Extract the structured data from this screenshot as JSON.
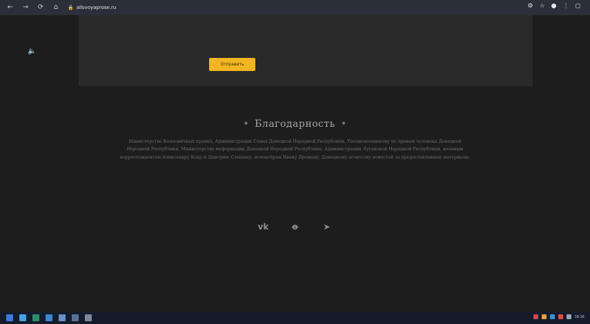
{
  "browser": {
    "url": "allsvoyaprose.ru",
    "nav": [
      "←",
      "→",
      "⟳",
      "⌂"
    ]
  },
  "form": {
    "consent_text": "",
    "submit_label": "Отправить"
  },
  "thanks": {
    "title": "Благодарность",
    "text": "Министерство Колесничных правил, Администрации Главы Донецкой Народной Республики, Уполномоченному по правам человека Донецкой Народной Республики, Министерству информации Донецкой Народной Республики, Администрации Луганской Народной Республики, военным корреспондентам Александру Коцу и Дмитрию Стешину, волонтёрам Ивану Яроману, Донецкому агентству новостей за предоставленные материалы."
  },
  "socials": [
    "VK",
    "OK",
    "Telegram"
  ],
  "taskbar": {
    "time": "16:16"
  },
  "colors": {
    "accent": "#f2b523",
    "background": "#1d1d1d",
    "card": "#2a2a2a"
  }
}
